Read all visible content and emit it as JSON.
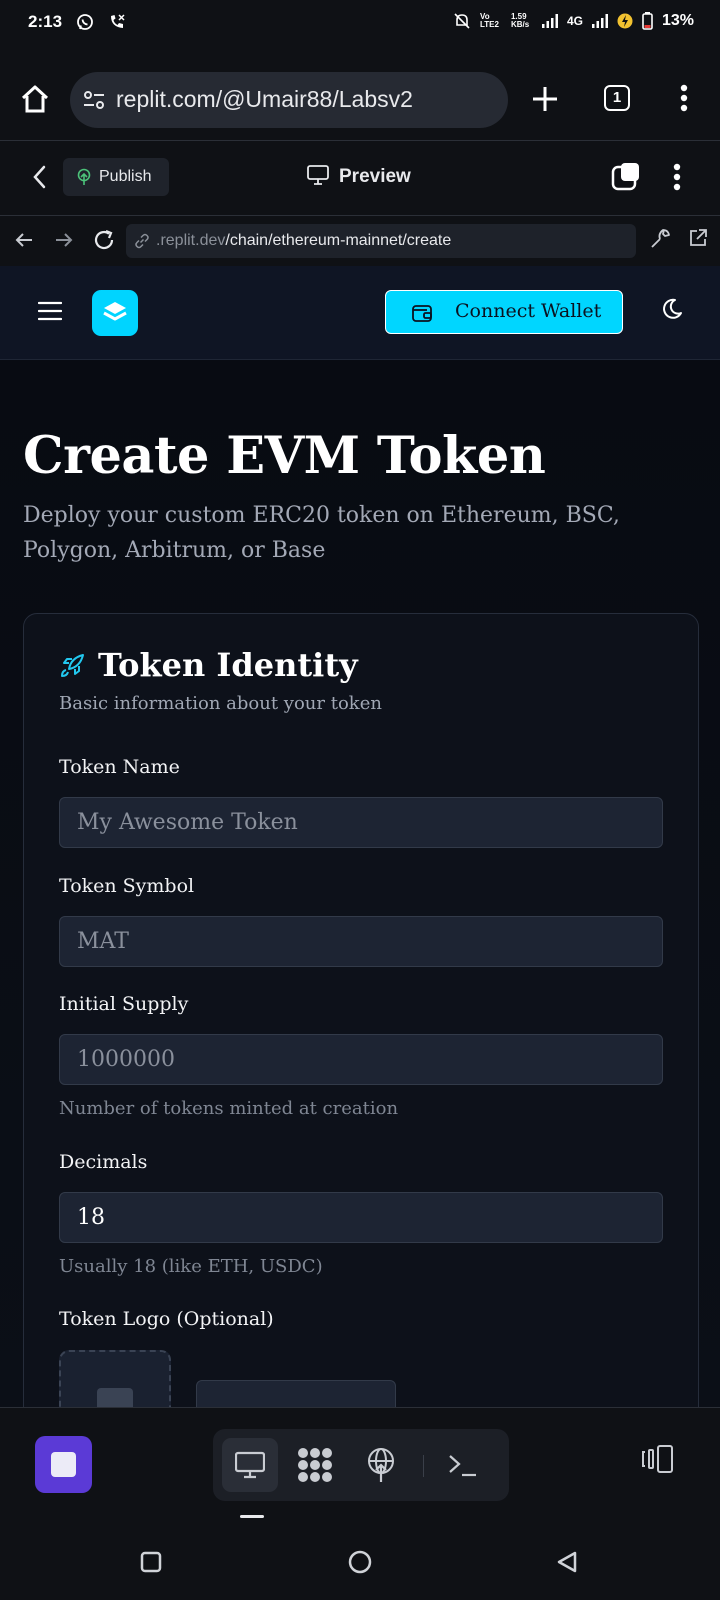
{
  "status_bar": {
    "time": "2:13",
    "network_label": "4G",
    "battery": "13%"
  },
  "browser": {
    "url": "replit.com/@Umair88/Labsv2",
    "tab_count": "1"
  },
  "replit": {
    "publish_label": "Publish",
    "preview_label": "Preview",
    "preview_url_domain": ".replit.dev",
    "preview_url_path": "/chain/ethereum-mainnet/create"
  },
  "app": {
    "connect_wallet_label": "Connect Wallet",
    "accent_color": "#00d6ff"
  },
  "page": {
    "title": "Create EVM Token",
    "subtitle": "Deploy your custom ERC20 token on Ethereum, BSC, Polygon, Arbitrum, or Base"
  },
  "card": {
    "title": "Token Identity",
    "subtitle": "Basic information about your token",
    "fields": [
      {
        "label": "Token Name",
        "placeholder": "My Awesome Token",
        "value": ""
      },
      {
        "label": "Token Symbol",
        "placeholder": "MAT",
        "value": ""
      },
      {
        "label": "Initial Supply",
        "placeholder": "1000000",
        "value": "",
        "help": "Number of tokens minted at creation"
      },
      {
        "label": "Decimals",
        "placeholder": "",
        "value": "18",
        "help": "Usually 18 (like ETH, USDC)"
      }
    ],
    "logo_label": "Token Logo (Optional)"
  }
}
